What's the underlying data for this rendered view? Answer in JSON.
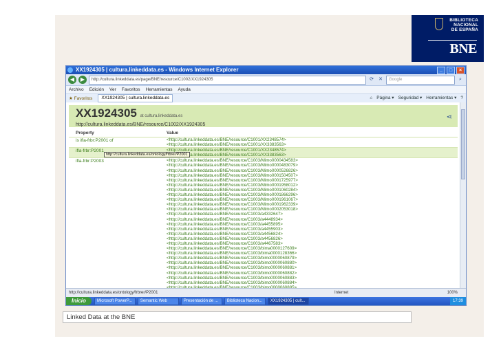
{
  "logo": {
    "line1": "BIBLIOTECA",
    "line2": "NACIONAL",
    "line3": "DE ESPAÑA",
    "big": "BNE"
  },
  "window": {
    "title": "XX1924305 | cultura.linkeddata.es - Windows Internet Explorer",
    "address": "http://cultura.linkeddata.es/page/BNE/resource/C1002/XX1924305",
    "search_placeholder": "Google",
    "menu": [
      "Archivo",
      "Edición",
      "Ver",
      "Favoritos",
      "Herramientas",
      "Ayuda"
    ],
    "favorites_label": "Favoritos",
    "tab_label": "XX1924305 | cultura.linkeddata.es",
    "toolbar_right": [
      "Página ▾",
      "Seguridad ▾",
      "Herramientas ▾"
    ]
  },
  "page": {
    "title": "XX1924305",
    "title_suffix": "at cultura.linkeddata.es",
    "uri": "http://cultura.linkeddata.es/BNE/resource/C1002/XX1924305",
    "col_property": "Property",
    "col_value": "Value",
    "tooltip": "http://cultura.linkeddata.es/ontology/frbrer/P2001",
    "rows": [
      {
        "property": "is ifla-frbr:P2001 of",
        "values": [
          "<http://cultura.linkeddata.es/BNE/resource/C1001/XX2348574>",
          "<http://cultura.linkeddata.es/BNE/resource/C1001/XX3383563>"
        ]
      },
      {
        "property": "ifla-frbr:P2001",
        "values": [
          "<http://cultura.linkeddata.es/BNE/resource/C1001/XX2348574>",
          "<http://cultura.linkeddata.es/BNE/resource/C1001/XX3383563>"
        ]
      },
      {
        "property": "ifla-frbr:P2003",
        "values": [
          "<http://cultura.linkeddata.es/BNE/resource/C1003/Mimo0000434583>",
          "<http://cultura.linkeddata.es/BNE/resource/C1003/Mimo0000483079>",
          "<http://cultura.linkeddata.es/BNE/resource/C1003/Mimo0000526826>",
          "<http://cultura.linkeddata.es/BNE/resource/C1003/Mimo0001504507>",
          "<http://cultura.linkeddata.es/BNE/resource/C1003/Mimo0001725977>",
          "<http://cultura.linkeddata.es/BNE/resource/C1003/Mimo0001958012>",
          "<http://cultura.linkeddata.es/BNE/resource/C1003/Mimo0001060284>",
          "<http://cultura.linkeddata.es/BNE/resource/C1003/Mimo0001866296>",
          "<http://cultura.linkeddata.es/BNE/resource/C1003/Mimo0001961067>",
          "<http://cultura.linkeddata.es/BNE/resource/C1003/Mimo0001962339>",
          "<http://cultura.linkeddata.es/BNE/resource/C1003/Mimo0002053018>",
          "<http://cultura.linkeddata.es/BNE/resource/C1003/a4332647>",
          "<http://cultura.linkeddata.es/BNE/resource/C1003/a4448934>",
          "<http://cultura.linkeddata.es/BNE/resource/C1003/a4455895>",
          "<http://cultura.linkeddata.es/BNE/resource/C1003/a4455903>",
          "<http://cultura.linkeddata.es/BNE/resource/C1003/a4456824>",
          "<http://cultura.linkeddata.es/BNE/resource/C1003/a4456826>",
          "<http://cultura.linkeddata.es/BNE/resource/C1003/a4467583>",
          "<http://cultura.linkeddata.es/BNE/resource/C1003/bima0000127609>",
          "<http://cultura.linkeddata.es/BNE/resource/C1003/bima0000128366>",
          "<http://cultura.linkeddata.es/BNE/resource/C1003/bimo0000060879>",
          "<http://cultura.linkeddata.es/BNE/resource/C1003/bimo0000060880>",
          "<http://cultura.linkeddata.es/BNE/resource/C1003/bimo0000060881>",
          "<http://cultura.linkeddata.es/BNE/resource/C1003/bimo0000060882>",
          "<http://cultura.linkeddata.es/BNE/resource/C1003/bimo0000060883>",
          "<http://cultura.linkeddata.es/BNE/resource/C1003/bimo0000060884>",
          "<http://cultura.linkeddata.es/BNE/resource/C1003/bimo0000060885>"
        ]
      }
    ]
  },
  "status": {
    "url": "http://cultura.linkeddata.es/ontology/frbrer/P2001",
    "zone": "Internet",
    "zoom": "100%"
  },
  "taskbar": {
    "start": "Inicio",
    "tasks": [
      "Microsoft PowerP...",
      "Semantic Web",
      "Presentación de ...",
      "Biblioteca Nacion...",
      "XX1924305 | cult..."
    ],
    "clock": "17:39"
  },
  "caption": "Linked Data at the BNE"
}
